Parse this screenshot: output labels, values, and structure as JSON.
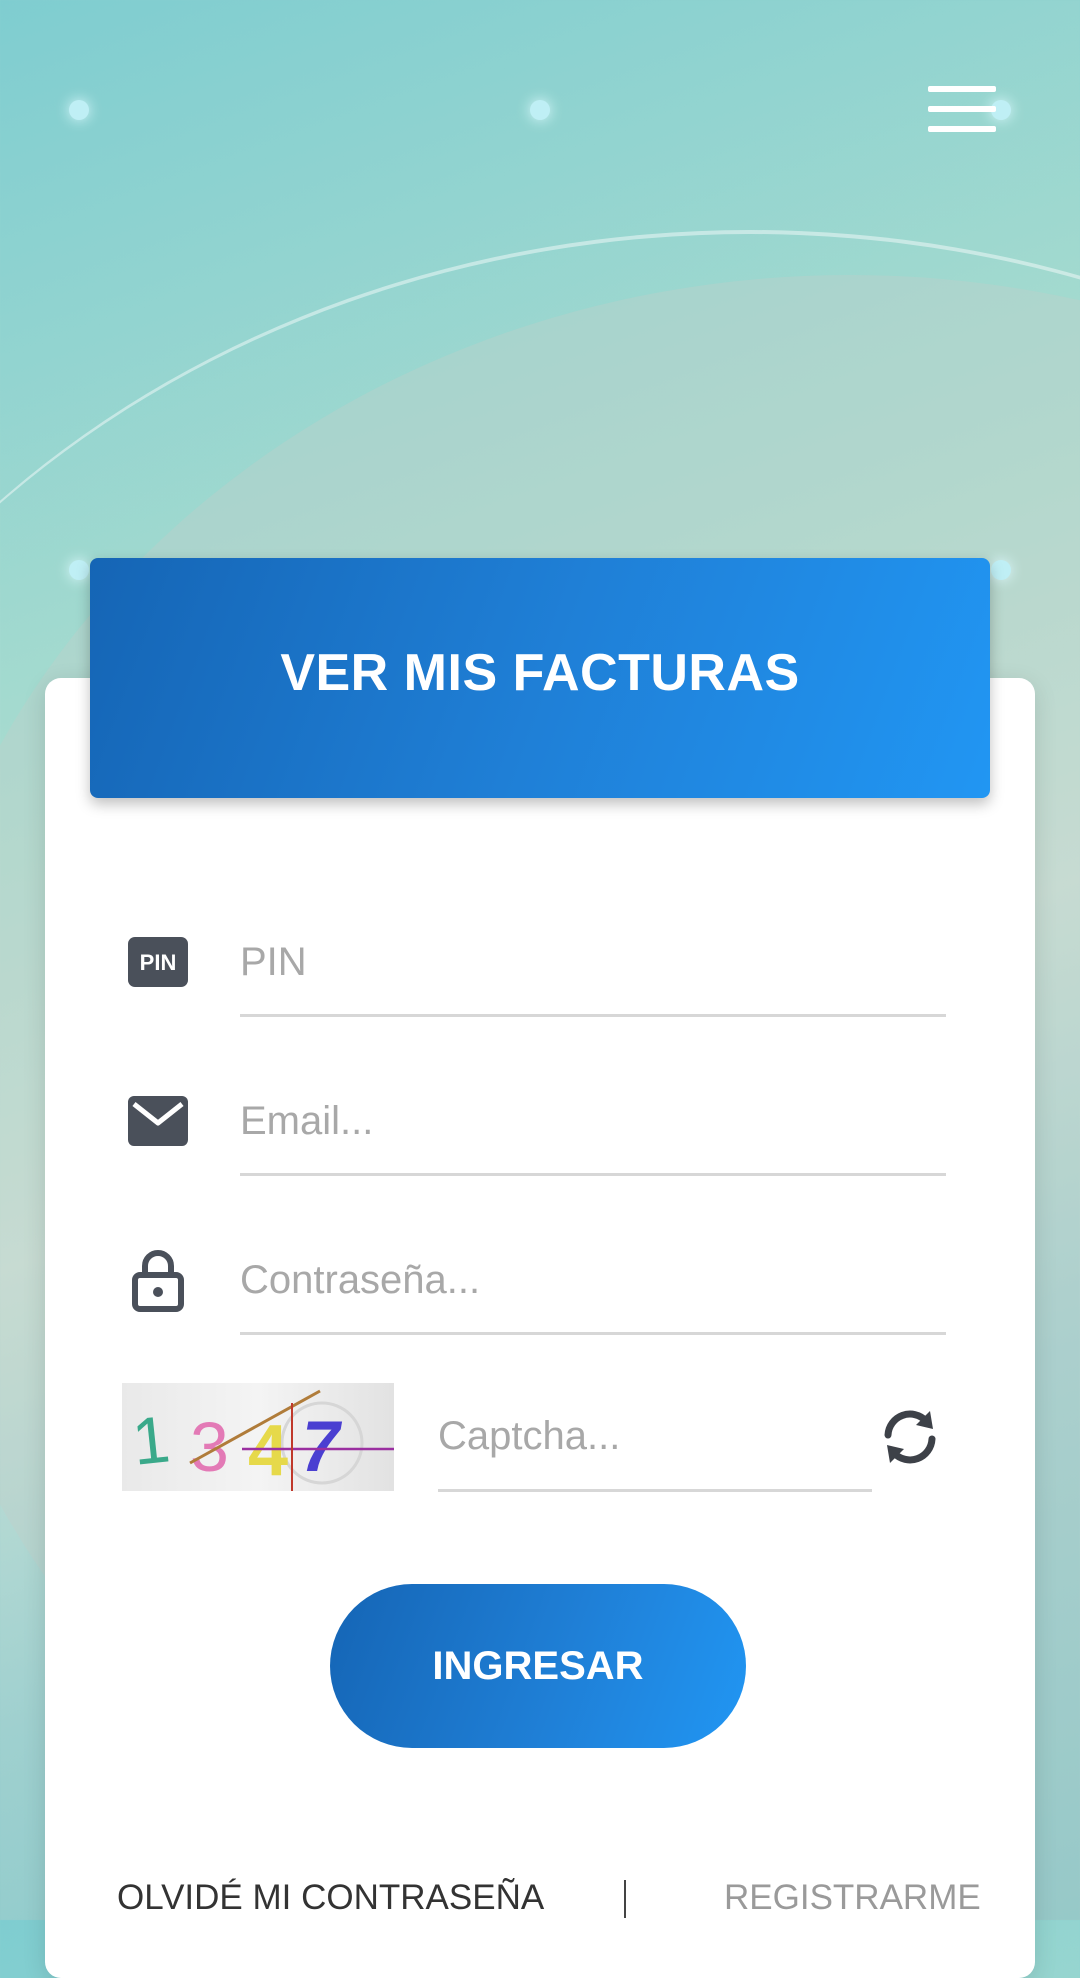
{
  "header": {
    "title": "VER MIS FACTURAS"
  },
  "form": {
    "pin_placeholder": "PIN",
    "pin_icon_text": "PIN",
    "email_placeholder": "Email...",
    "password_placeholder": "Contraseña...",
    "captcha_placeholder": "Captcha...",
    "captcha_image_text": "1347"
  },
  "actions": {
    "submit_label": "INGRESAR",
    "forgot_label": "OLVIDÉ MI CONTRASEÑA",
    "register_label": "REGISTRARME"
  },
  "colors": {
    "primary": "#1f7fd6",
    "icon": "#4a505a"
  },
  "icons": [
    "menu-icon",
    "pin-icon",
    "email-icon",
    "lock-icon",
    "refresh-icon"
  ]
}
